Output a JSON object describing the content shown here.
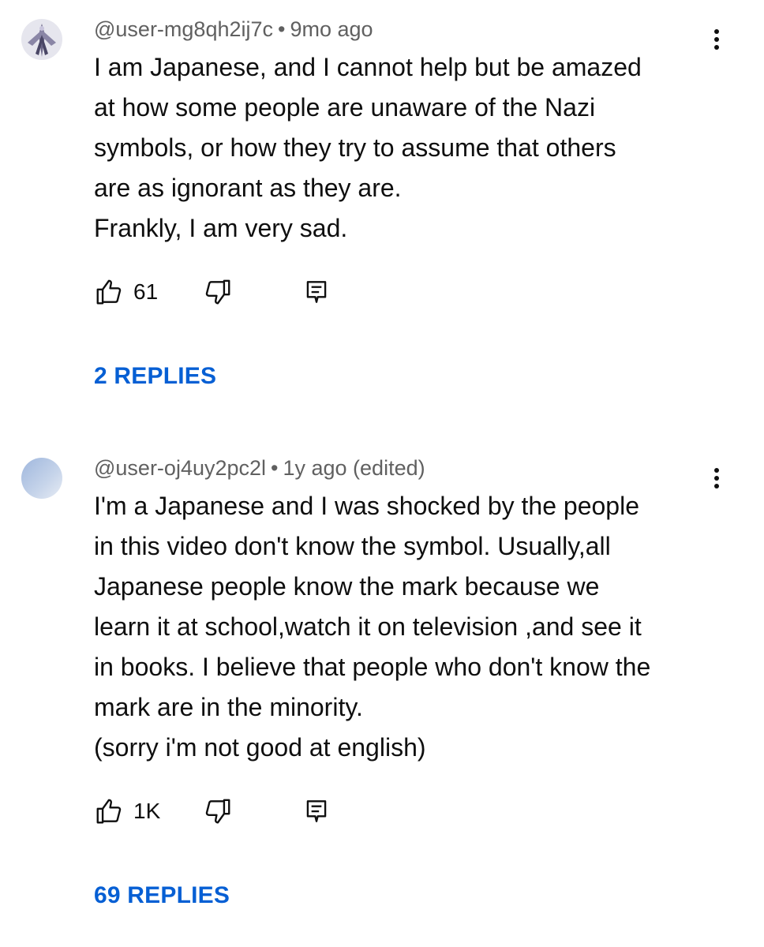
{
  "comments": [
    {
      "author": "@user-mg8qh2ij7c",
      "separator": "•",
      "time": "9mo ago",
      "lines": [
        "I am Japanese, and I cannot help but be amazed",
        "at how some people are unaware of the Nazi",
        "symbols, or how they try to assume that others",
        "are as ignorant as they are.",
        "Frankly, I am very sad."
      ],
      "likes": "61",
      "replies": "2 REPLIES",
      "avatar": "robot-figure"
    },
    {
      "author": "@user-oj4uy2pc2l",
      "separator": "•",
      "time": "1y ago (edited)",
      "lines": [
        "I'm a Japanese and I was shocked by the people",
        "in this video don't know the symbol. Usually,all",
        "Japanese people know the mark because we",
        "learn it at school,watch it on television ,and see it",
        "in books. I believe that people who don't know the",
        "mark are in the minority.",
        "(sorry i'm not good at english)"
      ],
      "likes": "1K",
      "replies": "69 REPLIES",
      "avatar": "sky-gradient"
    }
  ],
  "icons": {
    "like": "thumbs-up-icon",
    "dislike": "thumbs-down-icon",
    "reply": "comment-reply-icon",
    "more": "more-vertical-icon"
  },
  "colors": {
    "link": "#065fd4",
    "meta": "#606060",
    "text": "#0f0f0f"
  }
}
